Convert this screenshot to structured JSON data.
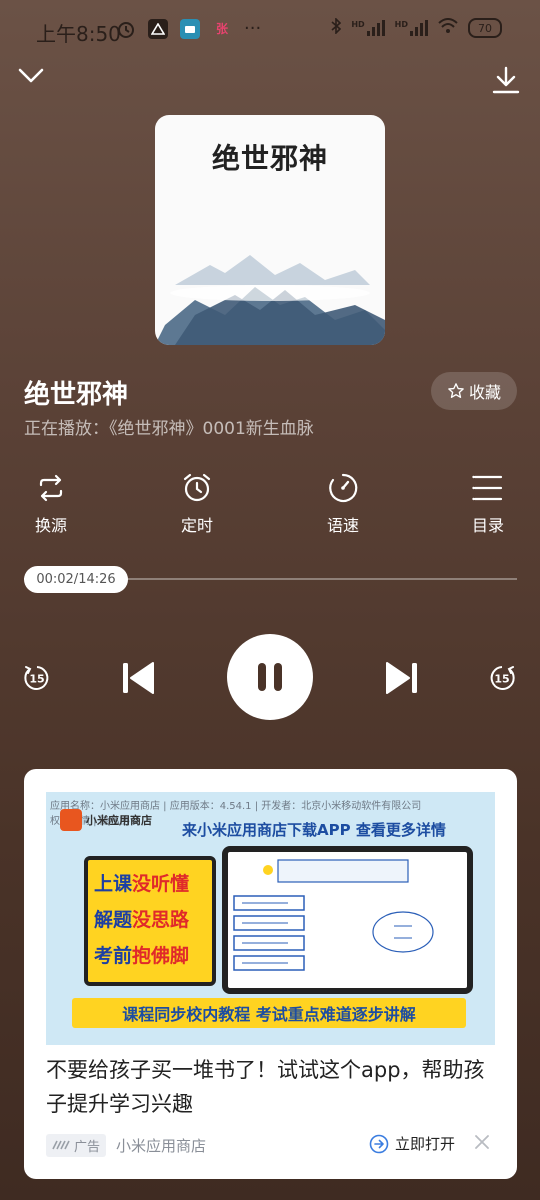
{
  "status": {
    "time": "上午8:50",
    "notif_badge": "张",
    "more": "···",
    "hd1": "HD",
    "hd2": "HD",
    "battery": "70"
  },
  "cover": {
    "title": "绝世邪神"
  },
  "book": {
    "title": "绝世邪神",
    "favorite_label": "收藏",
    "now_playing": "正在播放：《绝世邪神》0001新生血脉"
  },
  "controls": [
    {
      "label": "换源",
      "icon": "switch-source-icon"
    },
    {
      "label": "定时",
      "icon": "alarm-clock-icon"
    },
    {
      "label": "语速",
      "icon": "speed-icon"
    },
    {
      "label": "目录",
      "icon": "list-icon"
    }
  ],
  "progress": {
    "current": "00:02",
    "total": "14:26",
    "time_label": "00:02/14:26",
    "fraction": 0.0023
  },
  "player": {
    "skip_back": "15",
    "skip_forward": "15",
    "state": "playing"
  },
  "ad": {
    "meta_line": "应用名称：小米应用商店 | 应用版本：4.54.1 | 开发者：北京小米移动软件有限公司",
    "meta_line2": "权限详情 | 隐私协议",
    "brand": "小米应用商店",
    "slogan": "来小米应用商店下载APP 查看更多详情",
    "promo": [
      {
        "a": "上课",
        "b": "没听懂"
      },
      {
        "a": "解题",
        "b": "没思路"
      },
      {
        "a": "考前",
        "b": "抱佛脚"
      }
    ],
    "bottom_banner": "课程同步校内教程 考试重点难道逐步讲解",
    "headline": "不要给孩子买一堆书了！试试这个app，帮助孩子提升学习兴趣",
    "tag": "广告",
    "source": "小米应用商店",
    "open_label": "立即打开"
  },
  "colors": {
    "background": "#5a4136",
    "accent_blue": "#1d4da1",
    "ad_yellow": "#ffd321"
  }
}
